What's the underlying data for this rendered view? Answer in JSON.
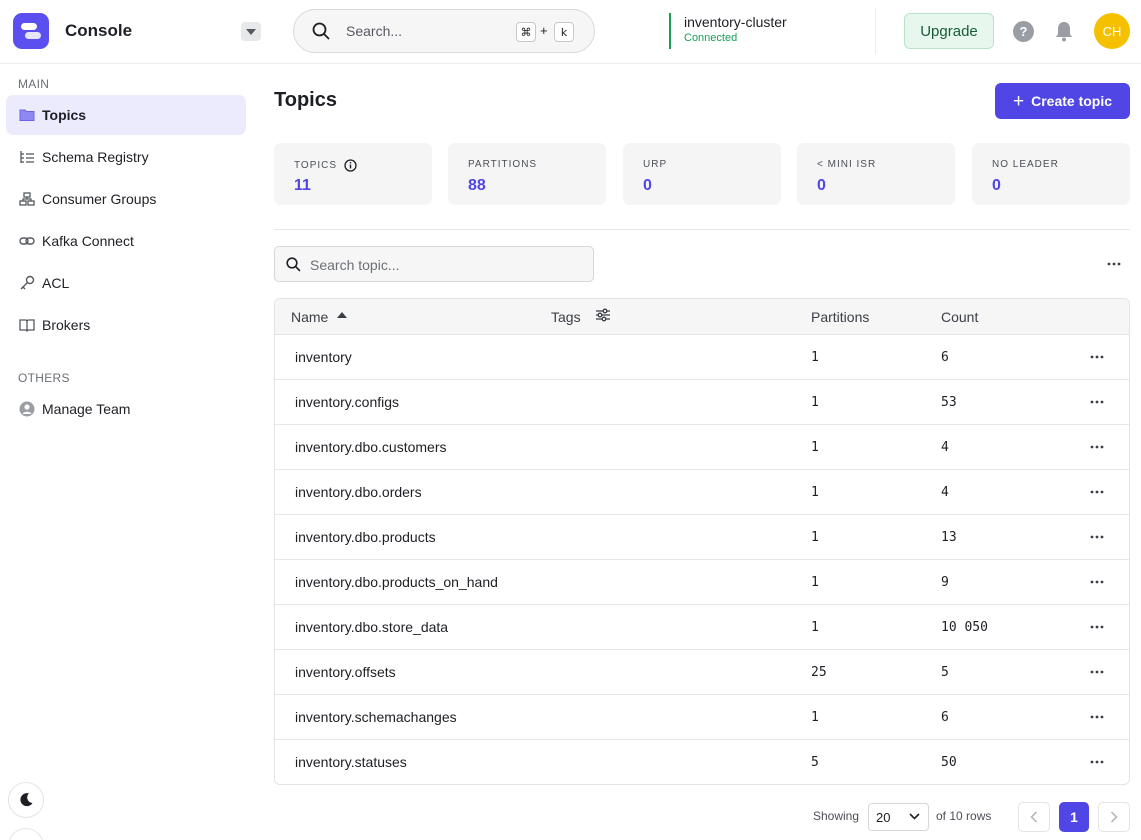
{
  "app": {
    "name": "Console"
  },
  "search": {
    "placeholder": "Search...",
    "shortcut_mod": "⌘",
    "shortcut_plus": "+",
    "shortcut_key": "k"
  },
  "cluster": {
    "name": "inventory-cluster",
    "status": "Connected"
  },
  "header": {
    "upgrade_label": "Upgrade",
    "help_label": "?",
    "avatar_initials": "CH"
  },
  "colors": {
    "accent": "#4f46e5",
    "connected": "#1a9e57",
    "avatar": "#f5c000"
  },
  "sidebar": {
    "main_label": "MAIN",
    "items": [
      {
        "label": "Topics",
        "icon": "folder-icon",
        "active": true
      },
      {
        "label": "Schema Registry",
        "icon": "schema-list-icon"
      },
      {
        "label": "Consumer Groups",
        "icon": "groups-icon"
      },
      {
        "label": "Kafka Connect",
        "icon": "link-icon"
      },
      {
        "label": "ACL",
        "icon": "key-icon"
      },
      {
        "label": "Brokers",
        "icon": "book-icon"
      }
    ],
    "others_label": "OTHERS",
    "others_items": [
      {
        "label": "Manage Team",
        "icon": "user-circle-icon"
      }
    ]
  },
  "main": {
    "title": "Topics",
    "create_label": "Create topic",
    "stats": [
      {
        "label": "TOPICS",
        "value": "11"
      },
      {
        "label": "PARTITIONS",
        "value": "88"
      },
      {
        "label": "URP",
        "value": "0"
      },
      {
        "label": "< MINI ISR",
        "value": "0"
      },
      {
        "label": "NO LEADER",
        "value": "0"
      }
    ],
    "topic_search_placeholder": "Search topic..."
  },
  "table": {
    "columns": {
      "name": "Name",
      "tags": "Tags",
      "partitions": "Partitions",
      "count": "Count"
    },
    "rows": [
      {
        "name": "inventory",
        "partitions": "1",
        "count": "6"
      },
      {
        "name": "inventory.configs",
        "partitions": "1",
        "count": "53"
      },
      {
        "name": "inventory.dbo.customers",
        "partitions": "1",
        "count": "4"
      },
      {
        "name": "inventory.dbo.orders",
        "partitions": "1",
        "count": "4"
      },
      {
        "name": "inventory.dbo.products",
        "partitions": "1",
        "count": "13"
      },
      {
        "name": "inventory.dbo.products_on_hand",
        "partitions": "1",
        "count": "9"
      },
      {
        "name": "inventory.dbo.store_data",
        "partitions": "1",
        "count": "10 050"
      },
      {
        "name": "inventory.offsets",
        "partitions": "25",
        "count": "5"
      },
      {
        "name": "inventory.schemachanges",
        "partitions": "1",
        "count": "6"
      },
      {
        "name": "inventory.statuses",
        "partitions": "5",
        "count": "50"
      }
    ]
  },
  "pagination": {
    "showing_label": "Showing",
    "page_size": "20",
    "of_rows": "of 10 rows",
    "current_page": "1"
  }
}
